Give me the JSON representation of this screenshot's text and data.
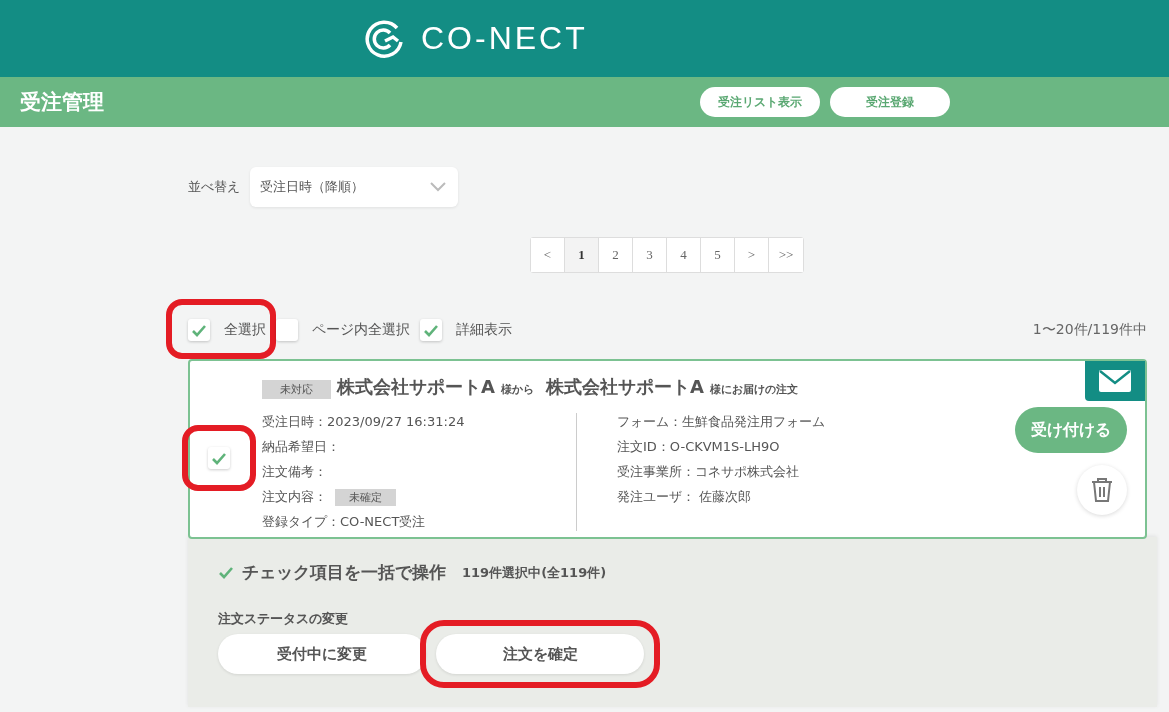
{
  "header": {
    "logo": "CO-NECT"
  },
  "subheader": {
    "title": "受注管理",
    "buttons": [
      "受注リスト表示",
      "受注登録"
    ]
  },
  "sort": {
    "label": "並べ替え",
    "value": "受注日時（降順）"
  },
  "pagination": [
    {
      "label": "<",
      "selected": false
    },
    {
      "label": "1",
      "selected": true
    },
    {
      "label": "2",
      "selected": false
    },
    {
      "label": "3",
      "selected": false
    },
    {
      "label": "4",
      "selected": false
    },
    {
      "label": "5",
      "selected": false
    },
    {
      "label": ">",
      "selected": false
    },
    {
      "label": ">>",
      "selected": false
    }
  ],
  "selection": {
    "options": [
      {
        "label": "全選択",
        "checked": true,
        "highlighted": true
      },
      {
        "label": "ページ内全選択",
        "checked": false,
        "highlighted": false
      },
      {
        "label": "詳細表示",
        "checked": true,
        "highlighted": false
      }
    ],
    "count": "1〜20件/119件中"
  },
  "order": {
    "status": "未対応",
    "sender": "株式会社サポートA",
    "sender_suffix": "様から",
    "recipient": "株式会社サポートA",
    "recipient_suffix": "様にお届けの注文",
    "checked": true,
    "highlighted": true,
    "left_fields": [
      {
        "text": "受注日時：2023/09/27 16:31:24"
      },
      {
        "text": "納品希望日："
      },
      {
        "text": "注文備考："
      },
      {
        "text": "注文内容：",
        "badge": "未確定"
      },
      {
        "text": "登録タイプ：CO-NECT受注"
      }
    ],
    "right_fields": [
      "フォーム：生鮮食品発注用フォーム",
      "注文ID：O-CKVM1S-LH9O",
      "受注事業所：コネサポ株式会社",
      "発注ユーザ： 佐藤次郎"
    ],
    "accept_button": "受け付ける"
  },
  "bulk": {
    "title": "チェック項目を一括で操作",
    "count": "119件選択中(全119件)",
    "section_label": "注文ステータスの変更",
    "buttons": [
      {
        "label": "受付中に変更",
        "highlighted": false
      },
      {
        "label": "注文を確定",
        "highlighted": true
      }
    ]
  }
}
